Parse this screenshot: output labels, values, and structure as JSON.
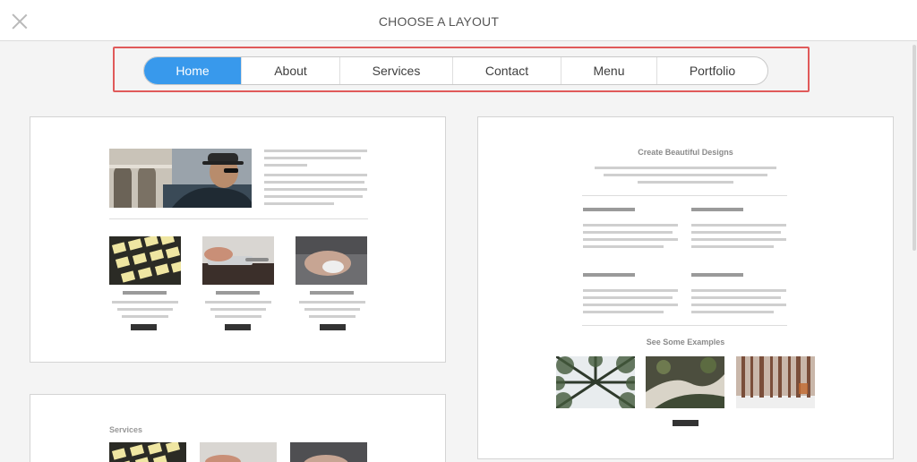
{
  "dialog": {
    "title": "CHOOSE A LAYOUT"
  },
  "tabs": [
    {
      "label": "Home",
      "active": true
    },
    {
      "label": "About",
      "active": false
    },
    {
      "label": "Services",
      "active": false
    },
    {
      "label": "Contact",
      "active": false
    },
    {
      "label": "Menu",
      "active": false
    },
    {
      "label": "Portfolio",
      "active": false
    }
  ],
  "layouts": {
    "right": {
      "heading": "Create Beautiful Designs",
      "examples_heading": "See Some Examples"
    },
    "bottom": {
      "heading": "Services"
    }
  },
  "colors": {
    "accent": "#3899ec",
    "highlight": "#e05a5a"
  }
}
